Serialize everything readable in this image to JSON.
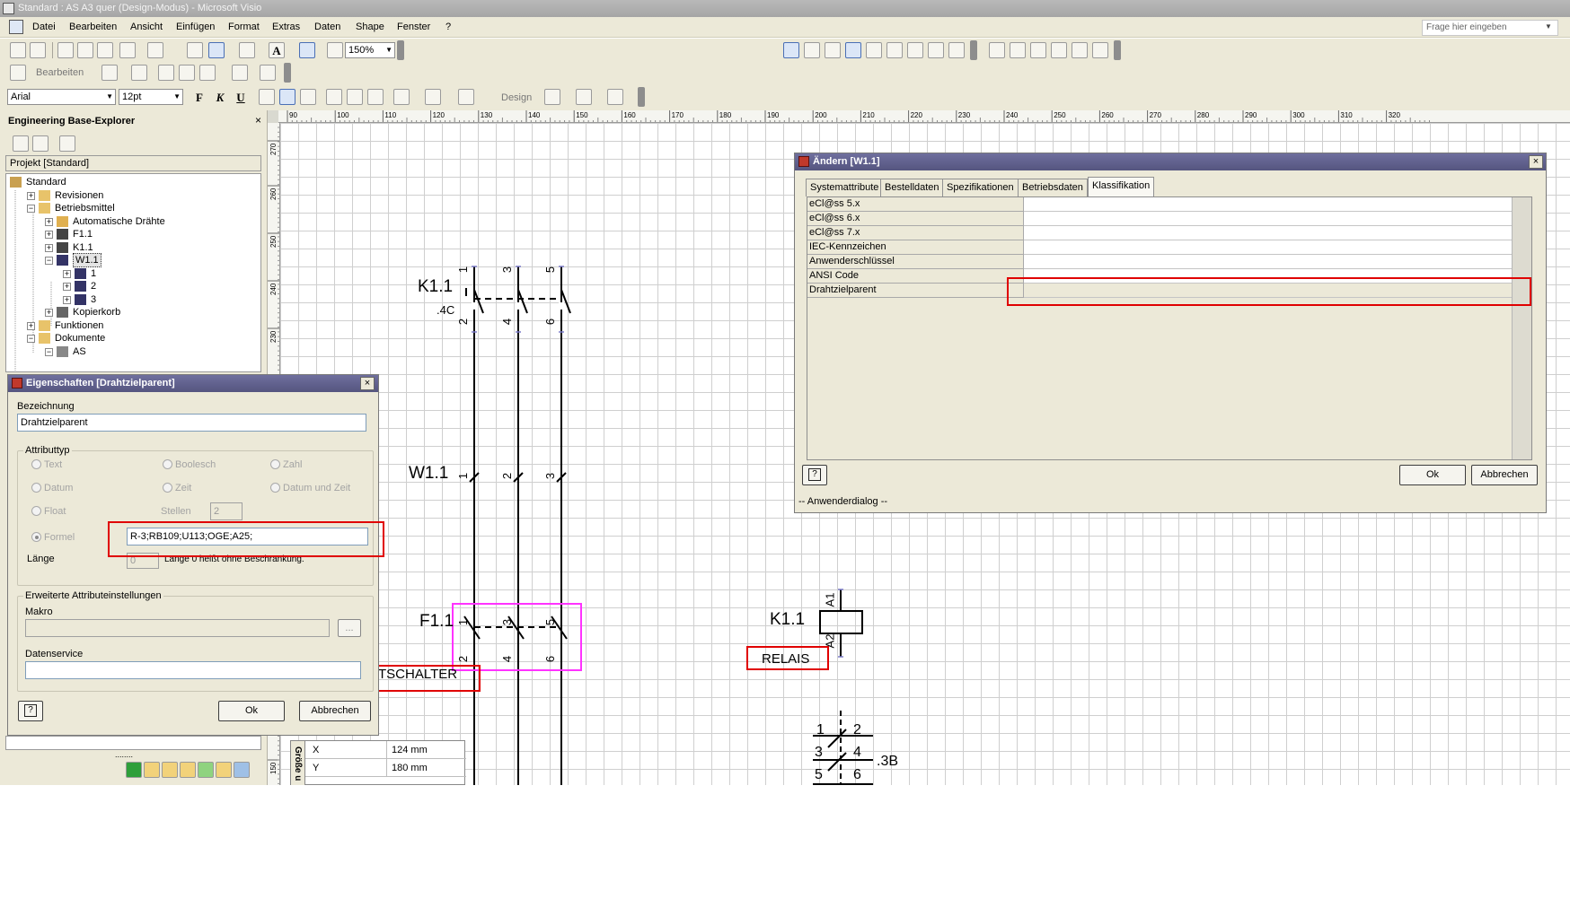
{
  "window": {
    "title": "Standard : AS A3 quer (Design-Modus) - Microsoft Visio"
  },
  "menu": {
    "items": [
      "Datei",
      "Bearbeiten",
      "Ansicht",
      "Einfügen",
      "Format",
      "Extras",
      "Daten",
      "Shape",
      "Fenster",
      "?"
    ],
    "help_placeholder": "Frage hier eingeben"
  },
  "toolbar": {
    "zoom": "150%",
    "font": "Arial",
    "size": "12pt",
    "edit_label": "Bearbeiten",
    "design_label": "Design",
    "bold": "F",
    "italic": "K",
    "underline": "U",
    "text_tool": "A"
  },
  "ruler": {
    "top_ticks": [
      "90",
      "100",
      "110",
      "120",
      "130",
      "140",
      "150",
      "160",
      "170",
      "180",
      "190",
      "200",
      "210",
      "220",
      "230",
      "240",
      "250",
      "260",
      "270",
      "280",
      "290",
      "300",
      "310",
      "320"
    ],
    "left_ticks": [
      "270",
      "260",
      "250",
      "240",
      "230",
      "150"
    ]
  },
  "explorer": {
    "title": "Engineering Base-Explorer",
    "close": "×",
    "project": "Projekt [Standard]",
    "tree": [
      {
        "label": "Standard",
        "depth": 0,
        "expander": ""
      },
      {
        "label": "Revisionen",
        "depth": 1,
        "expander": "+"
      },
      {
        "label": "Betriebsmittel",
        "depth": 1,
        "expander": "−"
      },
      {
        "label": "Automatische Drähte",
        "depth": 2,
        "expander": "+"
      },
      {
        "label": "F1.1",
        "depth": 2,
        "expander": "+"
      },
      {
        "label": "K1.1",
        "depth": 2,
        "expander": "+"
      },
      {
        "label": "W1.1",
        "depth": 2,
        "expander": "−",
        "selected": true
      },
      {
        "label": "1",
        "depth": 3,
        "expander": "+"
      },
      {
        "label": "2",
        "depth": 3,
        "expander": "+"
      },
      {
        "label": "3",
        "depth": 3,
        "expander": "+"
      },
      {
        "label": "Kopierkorb",
        "depth": 2,
        "expander": "+"
      },
      {
        "label": "Funktionen",
        "depth": 1,
        "expander": "+"
      },
      {
        "label": "Dokumente",
        "depth": 1,
        "expander": "−"
      },
      {
        "label": "AS",
        "depth": 2,
        "expander": "−"
      }
    ],
    "grip": "........"
  },
  "props_dialog": {
    "title": "Eigenschaften [Drahtzielparent]",
    "close": "×",
    "bezeichnung_label": "Bezeichnung",
    "bezeichnung_value": "Drahtzielparent",
    "attributtyp_label": "Attributtyp",
    "radios": [
      "Text",
      "Boolesch",
      "Zahl",
      "Datum",
      "Zeit",
      "Datum und Zeit",
      "Float"
    ],
    "stellen_label": "Stellen",
    "stellen_value": "2",
    "formel_label": "Formel",
    "formel_value": "R-3;RB109;U113;OGE;A25;",
    "laenge_label": "Länge",
    "laenge_value": "0",
    "laenge_hint": "Länge 0 heißt ohne Beschränkung.",
    "extended_label": "Erweiterte Attributeinstellungen",
    "makro_label": "Makro",
    "makro_button": "...",
    "datenservice_label": "Datenservice",
    "help": "?",
    "ok": "Ok",
    "cancel": "Abbrechen"
  },
  "change_dialog": {
    "title": "Ändern [W1.1]",
    "close": "×",
    "tabs": [
      "Systemattribute",
      "Bestelldaten",
      "Spezifikationen",
      "Betriebsdaten",
      "Klassifikation"
    ],
    "active_tab": "Klassifikation",
    "rows": [
      "eCl@ss 5.x",
      "eCl@ss 6.x",
      "eCl@ss 7.x",
      "IEC-Kennzeichen",
      "Anwenderschlüssel",
      "ANSI Code",
      "Drahtzielparent"
    ],
    "help": "?",
    "ok": "Ok",
    "cancel": "Abbrechen",
    "status": "-- Anwenderdialog --"
  },
  "schematic": {
    "k11_top": "K1.1",
    "k11_ref": ".4C",
    "k11_top_pins": [
      "1",
      "3",
      "5"
    ],
    "k11_bottom_pins": [
      "2",
      "4",
      "6"
    ],
    "w11": "W1.1",
    "w11_pins": [
      "1",
      "2",
      "3"
    ],
    "f11": "F1.1",
    "f11_top_pins": [
      "1",
      "3",
      "5"
    ],
    "f11_bottom_pins": [
      "2",
      "4",
      "6"
    ],
    "tschalter": "TSCHALTER",
    "k11_coil": "K1.1",
    "coil_a1": "A1",
    "coil_a2": "A2",
    "relais": "RELAIS",
    "contact_left": [
      "1",
      "3",
      "5"
    ],
    "contact_right": [
      "2",
      "4",
      "6"
    ],
    "contact_ref": ".3B"
  },
  "size_panel": {
    "side": "Größe u",
    "rows": [
      {
        "key": "X",
        "value": "124 mm"
      },
      {
        "key": "Y",
        "value": "180 mm"
      }
    ]
  }
}
